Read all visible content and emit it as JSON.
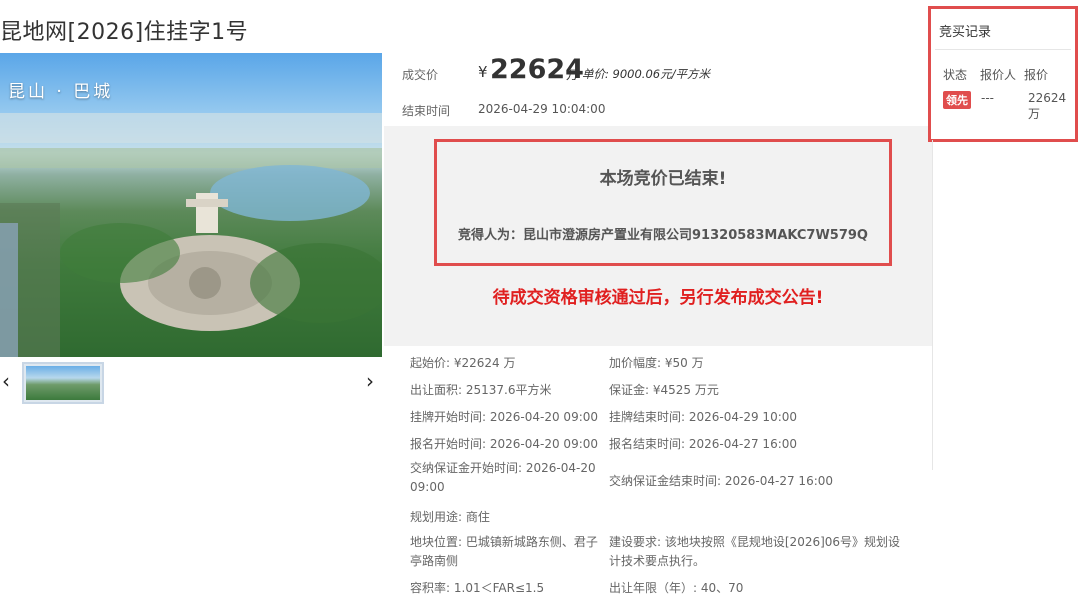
{
  "page": {
    "title": "昆地网[2026]住挂字1号"
  },
  "photo": {
    "caption": "昆山 · 巴城",
    "prev_icon": "‹",
    "next_icon": "›"
  },
  "deal": {
    "label": "成交价",
    "currency": "¥",
    "value": "22624",
    "unit": "万",
    "unit_price": "单价: 9000.06元/平方米",
    "end_label": "结束时间",
    "end_value": "2026-04-29 10:04:00"
  },
  "result": {
    "title": "本场竞价已结束!",
    "winner": "竞得人为：昆山市澄源房产置业有限公司91320583MAKC7W579Q",
    "note": "待成交资格审核通过后，另行发布成交公告!"
  },
  "records": {
    "title": "竞买记录",
    "headers": [
      "状态",
      "报价人",
      "报价"
    ],
    "rows": [
      {
        "status": "领先",
        "bidder": "---",
        "price": "22624 万"
      }
    ]
  },
  "details": {
    "start_price_label": "起始价:",
    "start_price": "¥22624 万",
    "increment_label": "加价幅度:",
    "increment": "¥50 万",
    "area_label": "出让面积:",
    "area": "25137.6平方米",
    "deposit_label": "保证金:",
    "deposit": "¥4525 万元",
    "listing_start_label": "挂牌开始时间:",
    "listing_start": "2026-04-20 09:00",
    "listing_end_label": "挂牌结束时间:",
    "listing_end": "2026-04-29 10:00",
    "reg_start_label": "报名开始时间:",
    "reg_start": "2026-04-20 09:00",
    "reg_end_label": "报名结束时间:",
    "reg_end": "2026-04-27 16:00",
    "dep_start_label": "交纳保证金开始时间:",
    "dep_start": "2026-04-20 09:00",
    "dep_end_label": "交纳保证金结束时间:",
    "dep_end": "2026-04-27 16:00",
    "use_label": "规划用途:",
    "use": "商住",
    "location_label": "地块位置:",
    "location": "巴城镇新城路东侧、君子亭路南侧",
    "req_label": "建设要求:",
    "req": "该地块按照《昆规地设[2026]06号》规划设计技术要点执行。",
    "far_label": "容积率:",
    "far": "1.01＜FAR≤1.5",
    "term_label": "出让年限（年）:",
    "term": "40、70"
  }
}
